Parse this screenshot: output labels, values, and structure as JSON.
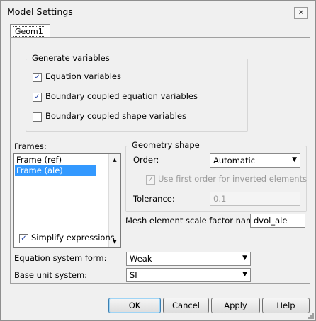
{
  "window": {
    "title": "Model Settings",
    "close_glyph": "✕"
  },
  "tabs": [
    {
      "label": "Geom1"
    }
  ],
  "generate_variables": {
    "legend": "Generate variables",
    "items": [
      {
        "label": "Equation variables",
        "checked": true
      },
      {
        "label": "Boundary coupled equation variables",
        "checked": true
      },
      {
        "label": "Boundary coupled shape variables",
        "checked": false
      }
    ]
  },
  "frames": {
    "label": "Frames:",
    "items": [
      {
        "label": "Frame (ref)",
        "selected": false
      },
      {
        "label": "Frame (ale)",
        "selected": true
      }
    ],
    "scroll_up": "▲",
    "scroll_down": "▼"
  },
  "geometry_shape": {
    "legend": "Geometry shape",
    "order_label": "Order:",
    "order_value": "Automatic",
    "first_order_label": "Use first order for inverted elements",
    "first_order_checked": true,
    "tolerance_label": "Tolerance:",
    "tolerance_value": "0.1"
  },
  "mesh": {
    "label": "Mesh element scale factor name:",
    "value": "dvol_ale"
  },
  "simplify": {
    "label": "Simplify expressions",
    "checked": true
  },
  "equation_system_form": {
    "label": "Equation system form:",
    "value": "Weak"
  },
  "base_unit_system": {
    "label": "Base unit system:",
    "value": "SI"
  },
  "glyphs": {
    "check": "✓",
    "dropdown": "▼"
  },
  "buttons": {
    "ok": "OK",
    "cancel": "Cancel",
    "apply": "Apply",
    "help": "Help"
  }
}
